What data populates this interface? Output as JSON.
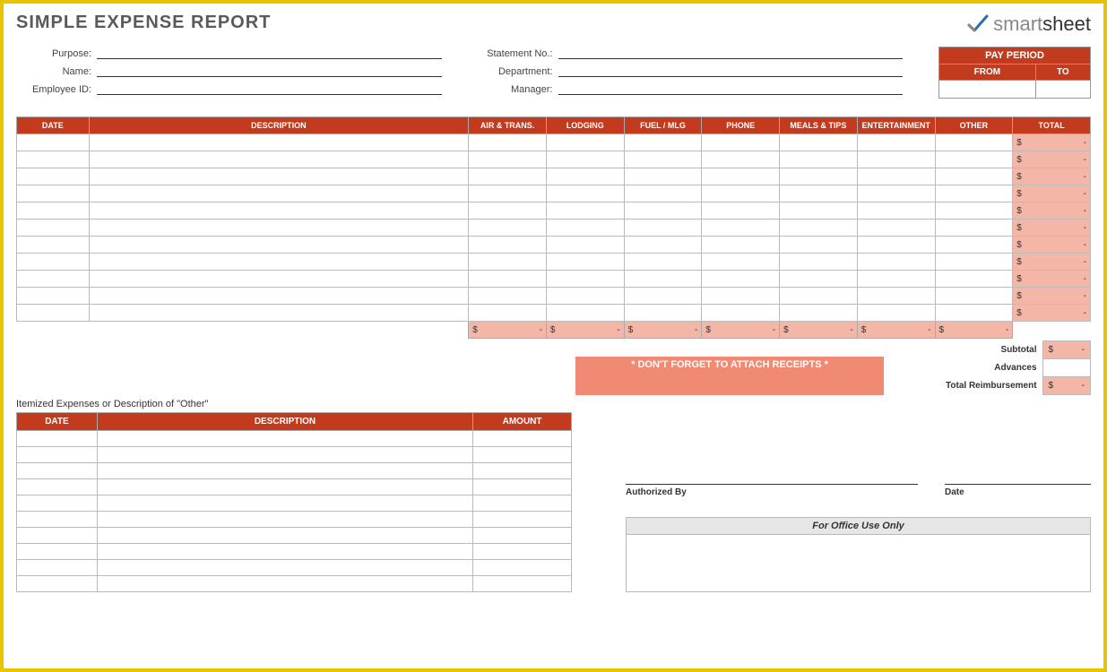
{
  "title": "SIMPLE EXPENSE REPORT",
  "logo": {
    "brand_a": "smart",
    "brand_b": "sheet"
  },
  "header": {
    "left": [
      {
        "label": "Purpose:"
      },
      {
        "label": "Name:"
      },
      {
        "label": "Employee ID:"
      }
    ],
    "right": [
      {
        "label": "Statement No.:"
      },
      {
        "label": "Department:"
      },
      {
        "label": "Manager:"
      }
    ]
  },
  "pay_period": {
    "title": "PAY PERIOD",
    "from": "FROM",
    "to": "TO"
  },
  "main_headers": [
    "DATE",
    "DESCRIPTION",
    "AIR & TRANS.",
    "LODGING",
    "FUEL / MLG",
    "PHONE",
    "MEALS & TIPS",
    "ENTERTAINMENT",
    "OTHER",
    "TOTAL"
  ],
  "currency": "$",
  "dash": "-",
  "row_count": 11,
  "receipt_note": "* DON'T FORGET TO ATTACH RECEIPTS *",
  "summary": {
    "subtotal": "Subtotal",
    "advances": "Advances",
    "total": "Total Reimbursement"
  },
  "itemized": {
    "title": "Itemized Expenses or Description of \"Other\"",
    "headers": [
      "DATE",
      "DESCRIPTION",
      "AMOUNT"
    ],
    "row_count": 10
  },
  "signatures": {
    "auth": "Authorized By",
    "date": "Date"
  },
  "office": {
    "title": "For Office Use Only"
  }
}
